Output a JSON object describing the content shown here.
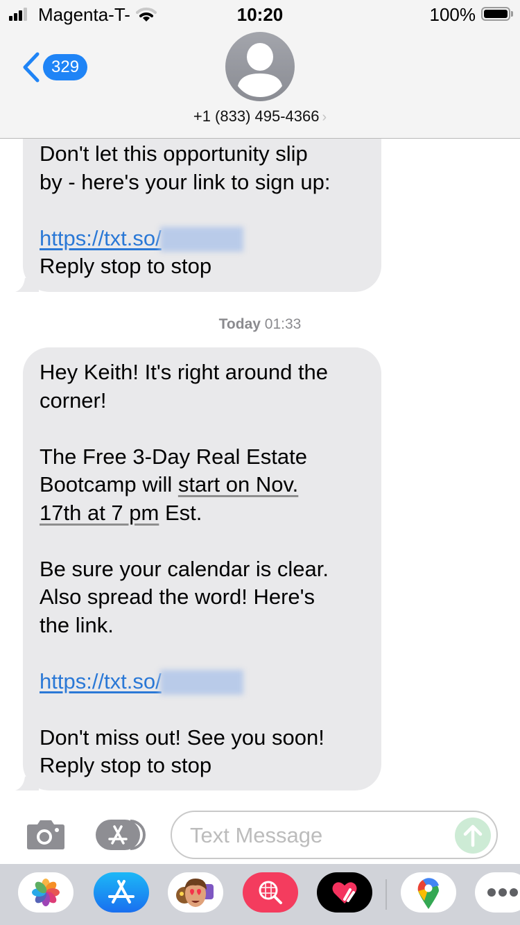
{
  "status_bar": {
    "carrier": "Magenta-T-",
    "time": "10:20",
    "battery_percent": "100%",
    "signal_bars": 3,
    "signal_bars_total": 4,
    "battery_level": 1.0
  },
  "header": {
    "back_badge": "329",
    "contact": "+1 (833) 495-4366",
    "contact_chevron": "›"
  },
  "messages": [
    {
      "direction": "incoming",
      "lines_before_link": [
        "Don't let this opportunity slip",
        "by - here's your link to sign up:"
      ],
      "link_text": "https://txt.so/",
      "link_redacted": true,
      "after_link": "Reply stop to stop"
    },
    {
      "direction": "incoming",
      "timestamp_day": "Today",
      "timestamp_time": "01:33",
      "para1_line1": "Hey Keith! It's right around the",
      "para1_line2": "corner!",
      "para2_line1": "The Free 3-Day Real Estate",
      "para2_line2_plain": "Bootcamp will ",
      "para2_line2_link": "start on Nov.",
      "para2_line3_link": "17th at 7 pm",
      "para2_line3_plain": " Est.",
      "para3_line1": "Be sure your calendar is clear.",
      "para3_line2": "Also spread the word! Here's",
      "para3_line3": "the link.",
      "link_text": "https://txt.so/",
      "link_redacted": true,
      "para4_line1": "Don't miss out! See you soon!",
      "para4_line2": "Reply stop to stop"
    }
  ],
  "composer": {
    "placeholder": "Text Message",
    "value": ""
  },
  "app_drawer": {
    "apps": [
      "Photos",
      "App Store",
      "Memoji Stickers",
      "Images Search",
      "Digital Touch",
      "Google Maps",
      "More"
    ]
  },
  "colors": {
    "accent_blue": "#1f84f6",
    "link_blue": "#2a78d6",
    "bubble_gray": "#e9e9eb",
    "send_green_disabled": "#cdebd5"
  }
}
